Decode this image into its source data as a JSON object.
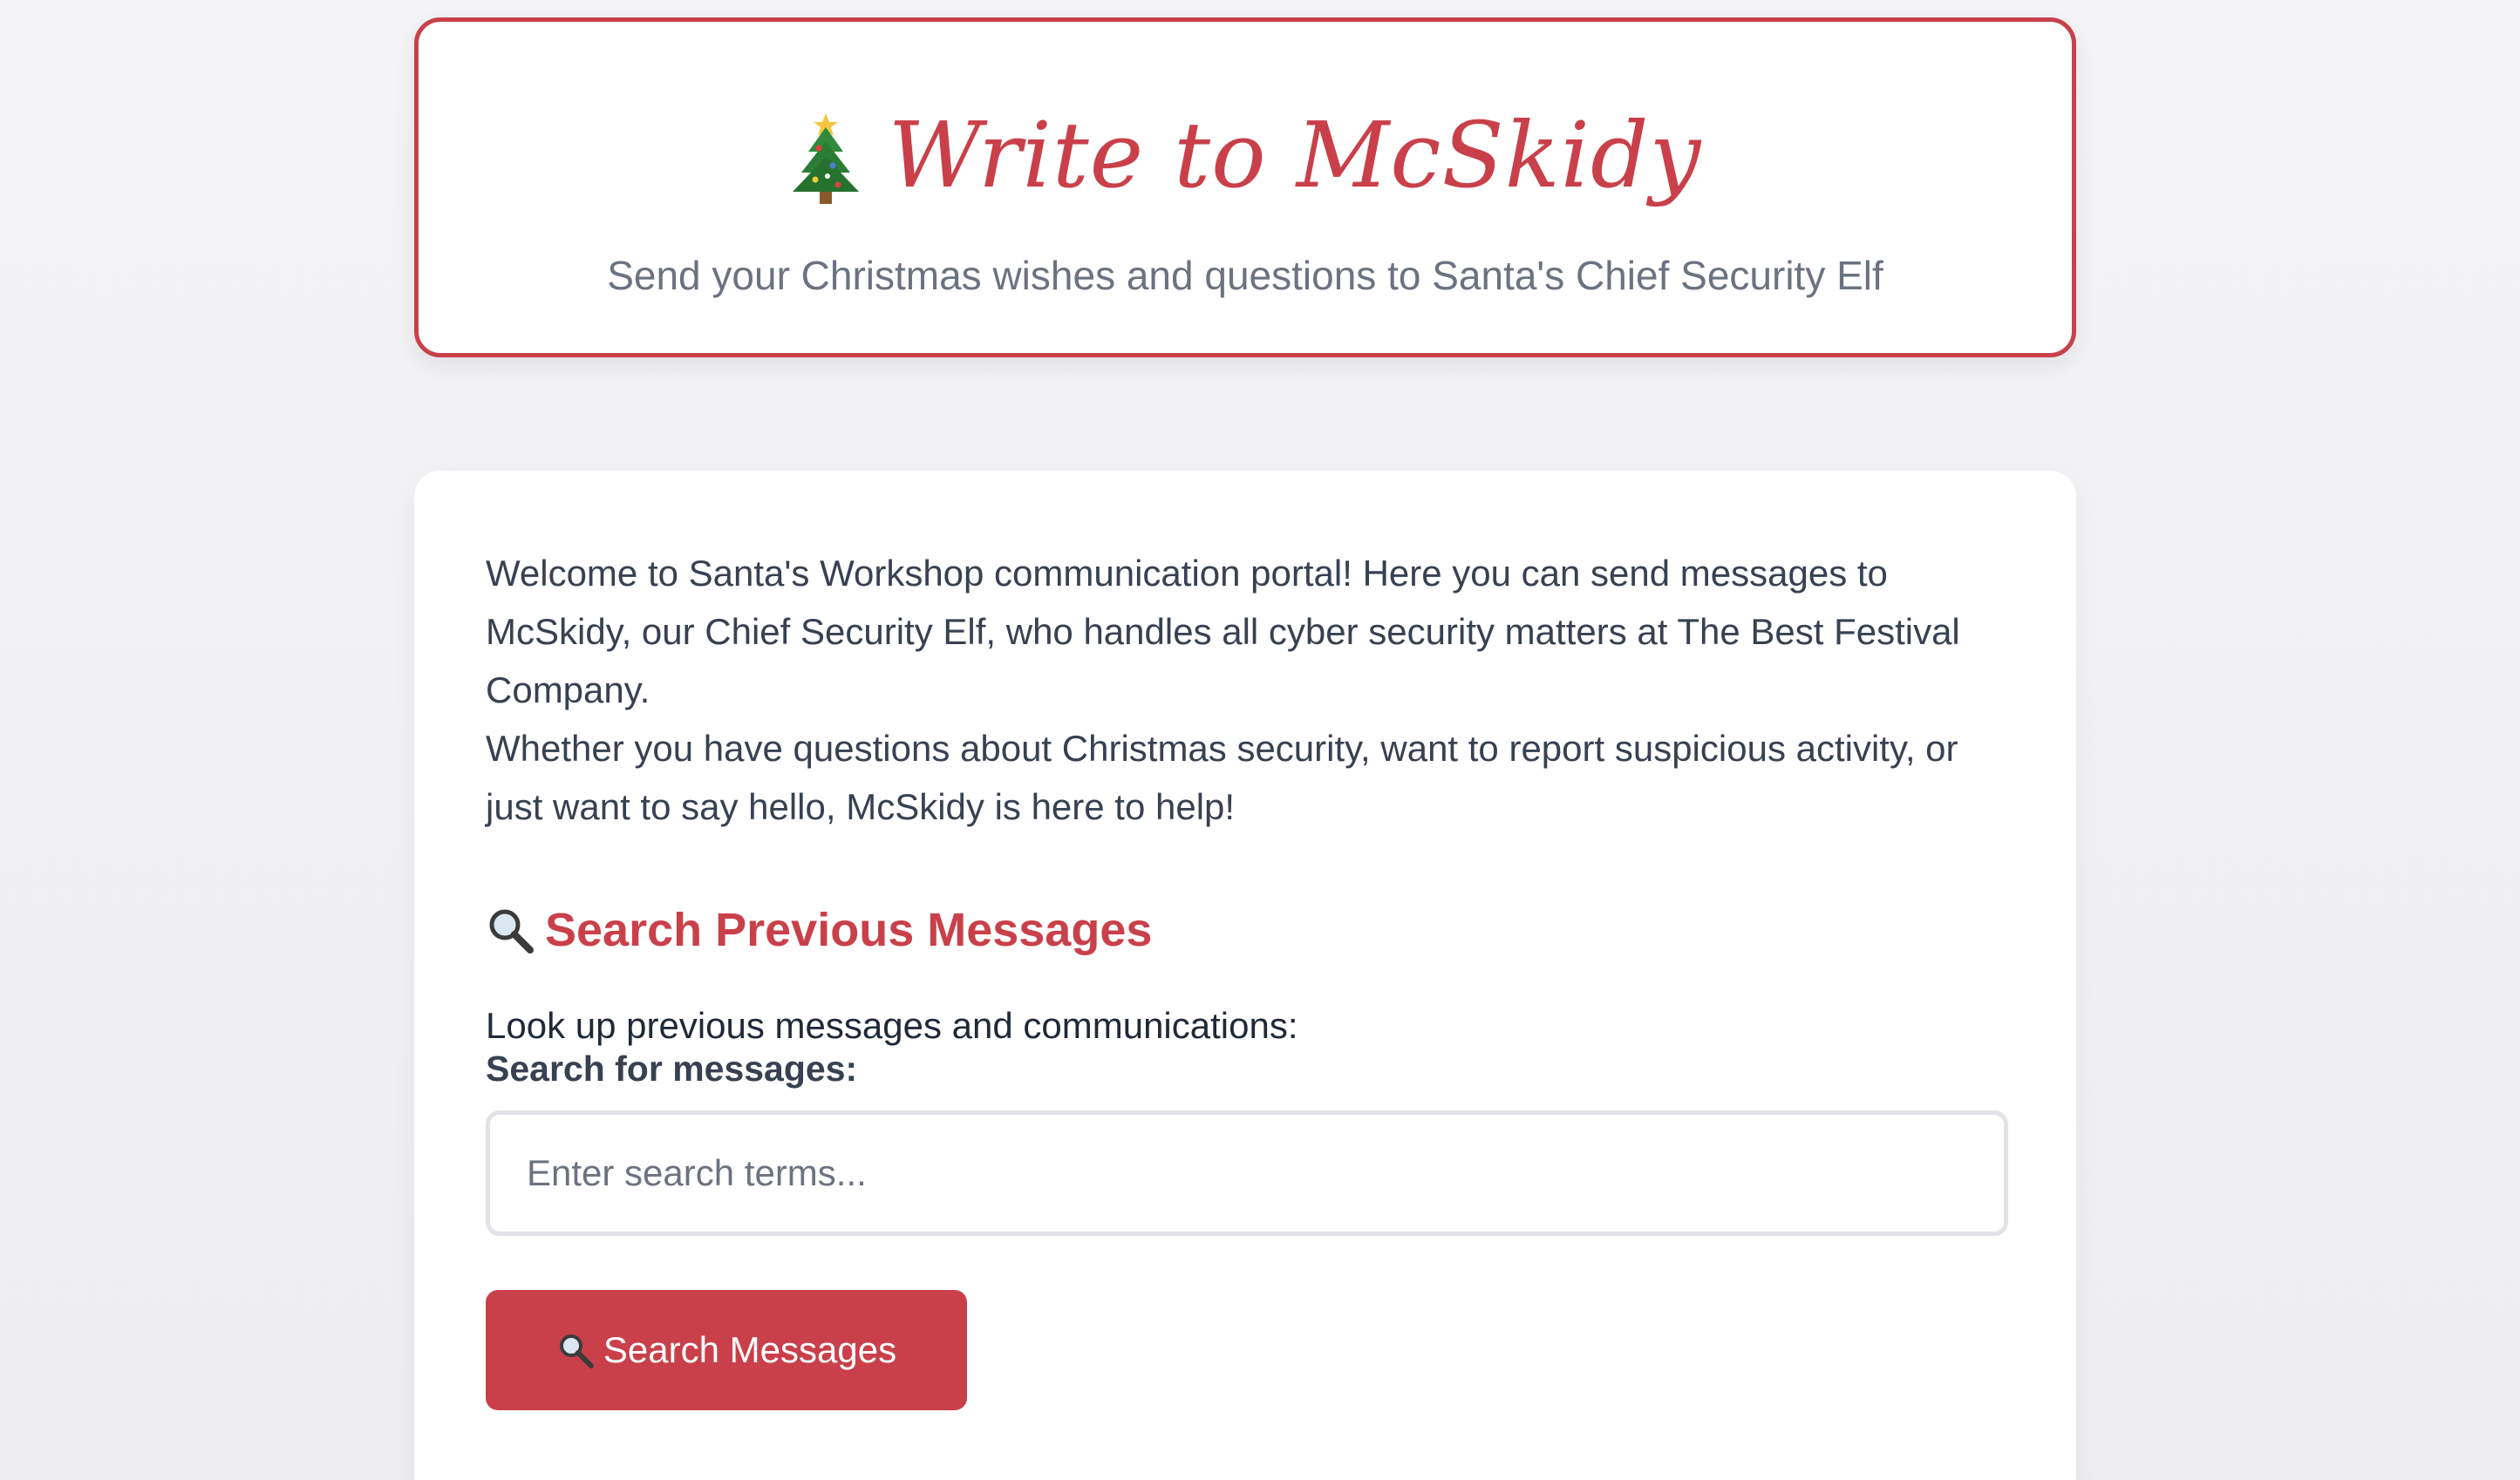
{
  "header": {
    "icon": "christmas-tree-icon",
    "title": "Write to McSkidy",
    "subtitle": "Send your Christmas wishes and questions to Santa's Chief Security Elf"
  },
  "intro": {
    "paragraph1": "Welcome to Santa's Workshop communication portal! Here you can send messages to McSkidy, our Chief Security Elf, who handles all cyber security matters at The Best Festival Company.",
    "paragraph2": "Whether you have questions about Christmas security, want to report suspicious activity, or just want to say hello, McSkidy is here to help!"
  },
  "search": {
    "section_icon": "magnifying-glass-icon",
    "section_title": "Search Previous Messages",
    "description": "Look up previous messages and communications:",
    "label": "Search for messages:",
    "placeholder": "Enter search terms...",
    "value": "",
    "button_icon": "magnifying-glass-icon",
    "button_label": "Search Messages"
  },
  "colors": {
    "accent": "#c9404a",
    "text": "#374151",
    "muted": "#6b7280",
    "input_border": "#e1e3e7",
    "background": "#f2f2f4"
  }
}
